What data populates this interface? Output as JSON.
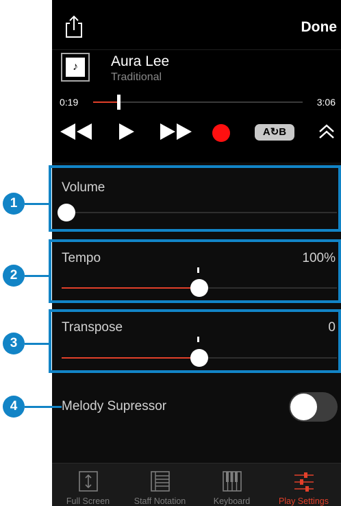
{
  "header": {
    "share_icon": "share-icon",
    "done_label": "Done"
  },
  "player": {
    "title": "Aura Lee",
    "artist": "Traditional",
    "current_time": "0:19",
    "total_time": "3:06",
    "progress": 0.12,
    "ab_label": "A↻B"
  },
  "settings": {
    "volume": {
      "label": "Volume",
      "value": 0.0
    },
    "tempo": {
      "label": "Tempo",
      "value_text": "100%",
      "value": 0.5
    },
    "transpose": {
      "label": "Transpose",
      "value_text": "0",
      "value": 0.5
    },
    "melody_supressor": {
      "label": "Melody Supressor",
      "enabled": false
    }
  },
  "tabs": [
    {
      "label": "Full Screen",
      "icon": "full-screen-icon",
      "active": false
    },
    {
      "label": "Staff Notation",
      "icon": "staff-notation-icon",
      "active": false
    },
    {
      "label": "Keyboard",
      "icon": "keyboard-icon",
      "active": false
    },
    {
      "label": "Play Settings",
      "icon": "play-settings-icon",
      "active": true
    }
  ],
  "callouts": [
    "1",
    "2",
    "3",
    "4"
  ],
  "colors": {
    "accent": "#e2402a",
    "callout": "#1284c6",
    "record": "#ff1010"
  }
}
